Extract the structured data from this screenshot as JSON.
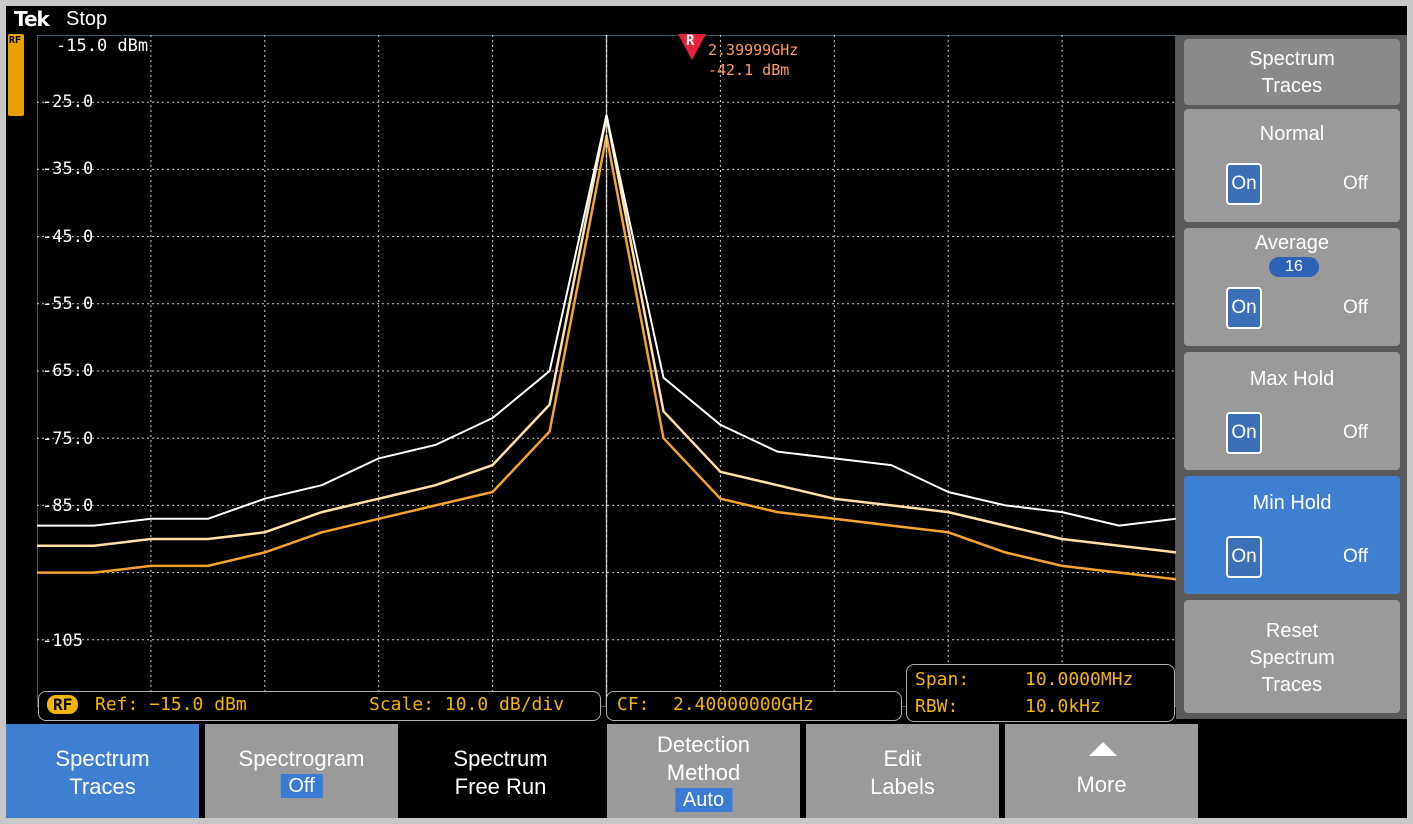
{
  "header": {
    "brand": "Tek",
    "status": "Stop"
  },
  "plot": {
    "ref_tag": "RF",
    "y_labels": [
      "-15.0 dBm",
      "-25.0",
      "-35.0",
      "-45.0",
      "-55.0",
      "-65.0",
      "-75.0",
      "-85.0",
      "",
      "-105"
    ],
    "marker": {
      "letter": "R",
      "frequency": "2.39999GHz",
      "level": "-42.1 dBm"
    }
  },
  "chart_data": {
    "type": "line",
    "xlabel": "",
    "ylabel": "",
    "ylim": [
      -115,
      -15
    ],
    "center_frequency": "2.40000000GHz",
    "span": "10.0000MHz",
    "series": [
      {
        "x": [
          2.395,
          2.3955,
          2.396,
          2.3965,
          2.397,
          2.3975,
          2.398,
          2.3985,
          2.399,
          2.3995,
          2.4,
          2.4005,
          2.401,
          2.4015,
          2.402,
          2.4025,
          2.403,
          2.4035,
          2.404,
          2.4045,
          2.405
        ],
        "y": [
          -88,
          -88,
          -87,
          -87,
          -84,
          -82,
          -78,
          -76,
          -72,
          -65,
          -27,
          -66,
          -73,
          -77,
          -78,
          -79,
          -83,
          -85,
          -86,
          -88,
          -87
        ],
        "color": "#ffffff"
      },
      {
        "x": [
          2.395,
          2.3955,
          2.396,
          2.3965,
          2.397,
          2.3975,
          2.398,
          2.3985,
          2.399,
          2.3995,
          2.4,
          2.4005,
          2.401,
          2.4015,
          2.402,
          2.4025,
          2.403,
          2.4035,
          2.404,
          2.4045,
          2.405
        ],
        "y": [
          -91,
          -91,
          -90,
          -90,
          -89,
          -86,
          -84,
          -82,
          -79,
          -70,
          -27,
          -71,
          -80,
          -82,
          -84,
          -85,
          -86,
          -88,
          -90,
          -91,
          -92
        ],
        "color": "#ffe1a8"
      },
      {
        "x": [
          2.395,
          2.3955,
          2.396,
          2.3965,
          2.397,
          2.3975,
          2.398,
          2.3985,
          2.399,
          2.3995,
          2.4,
          2.4005,
          2.401,
          2.4015,
          2.402,
          2.4025,
          2.403,
          2.4035,
          2.404,
          2.4045,
          2.405
        ],
        "y": [
          -95,
          -95,
          -94,
          -94,
          -92,
          -89,
          -87,
          -85,
          -83,
          -74,
          -30,
          -75,
          -84,
          -86,
          -87,
          -88,
          -89,
          -92,
          -94,
          -95,
          -96
        ],
        "color": "#f5a32e"
      }
    ]
  },
  "status_boxes": {
    "ref": {
      "badge": "RF",
      "ref": "Ref: −15.0 dBm",
      "scale": "Scale: 10.0 dB/div"
    },
    "cf": {
      "label": "CF:",
      "value": "2.40000000GHz"
    },
    "span": {
      "span_label": "Span:",
      "span_value": "10.0000MHz",
      "rbw_label": "RBW:",
      "rbw_value": "10.0kHz"
    }
  },
  "side_menu": {
    "title_line1": "Spectrum",
    "title_line2": "Traces",
    "normal": {
      "label": "Normal",
      "on": "On",
      "off": "Off"
    },
    "average": {
      "label": "Average",
      "count": "16",
      "on": "On",
      "off": "Off"
    },
    "max_hold": {
      "label": "Max Hold",
      "on": "On",
      "off": "Off"
    },
    "min_hold": {
      "label": "Min Hold",
      "on": "On",
      "off": "Off"
    },
    "reset": {
      "line1": "Reset",
      "line2": "Spectrum",
      "line3": "Traces"
    }
  },
  "bottom_bar": {
    "spectrum_traces": {
      "line1": "Spectrum",
      "line2": "Traces"
    },
    "spectrogram": {
      "line1": "Spectrogram",
      "value": "Off"
    },
    "free_run": {
      "line1": "Spectrum",
      "line2": "Free Run"
    },
    "detection": {
      "line1": "Detection",
      "line2": "Method",
      "value": "Auto"
    },
    "edit_labels": {
      "line1": "Edit",
      "line2": "Labels"
    },
    "more": {
      "label": "More"
    }
  },
  "colors": {
    "accent": "#3a7bd5",
    "trace_orange": "#f5a32e",
    "trace_white": "#ffffff",
    "label_yellow": "#f2b400",
    "marker": "#e8203a"
  }
}
